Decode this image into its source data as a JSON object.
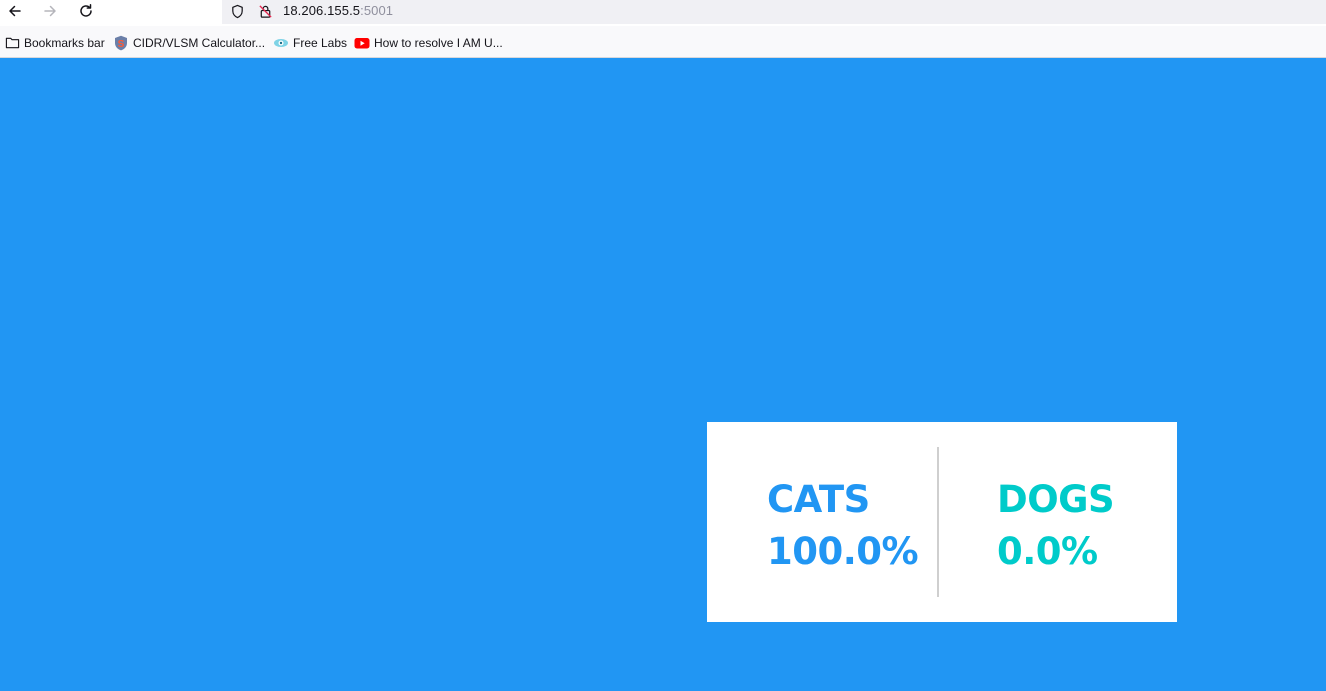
{
  "browser": {
    "url_host": "18.206.155.5",
    "url_port": ":5001",
    "bookmarks": [
      {
        "label": "Bookmarks bar",
        "icon": "folder-icon"
      },
      {
        "label": "CIDR/VLSM Calculator...",
        "icon": "site-s-icon"
      },
      {
        "label": "Free Labs",
        "icon": "eye-icon"
      },
      {
        "label": "How to resolve I AM U...",
        "icon": "youtube-icon"
      }
    ]
  },
  "results": {
    "option_a": {
      "label": "CATS",
      "percent": "100.0%",
      "color": "#2196f3"
    },
    "option_b": {
      "label": "DOGS",
      "percent": "0.0%",
      "color": "#00cbca"
    }
  },
  "colors": {
    "page_background": "#2196f3",
    "card_background": "#ffffff"
  }
}
